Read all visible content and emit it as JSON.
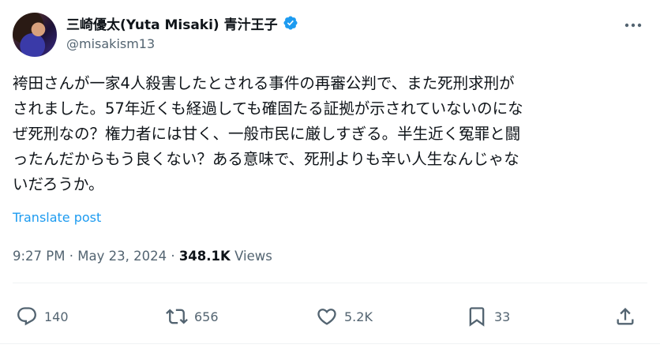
{
  "author": {
    "display_name": "三崎優太(Yuta Misaki) 青汁王子",
    "handle": "@misakism13",
    "verified": true
  },
  "post": {
    "lines": [
      "袴田さんが一家4人殺害したとされる事件の再審公判で、また死刑求刑が",
      "されました。57年近くも経過しても確固たる証拠が示されていないのにな",
      "ぜ死刑なの？権力者には甘く、一般市民に厳しすぎる。半生近く冤罪と闘",
      "ったんだからもう良くない？ある意味で、死刑よりも辛い人生なんじゃな",
      "いだろうか。"
    ],
    "translate_label": "Translate post"
  },
  "meta": {
    "time": "9:27 PM",
    "separator": " · ",
    "date": "May 23, 2024",
    "views_count": "348.1K",
    "views_label": "Views"
  },
  "actions": {
    "replies": "140",
    "reposts": "656",
    "likes": "5.2K",
    "bookmarks": "33"
  },
  "colors": {
    "accent": "#1d9bf0",
    "text": "#0f1419",
    "secondary": "#536471"
  },
  "icons": {
    "more": "more-dots-icon",
    "verified": "verified-badge-icon",
    "reply": "reply-icon",
    "repost": "repost-icon",
    "like": "heart-icon",
    "bookmark": "bookmark-icon",
    "share": "share-icon"
  }
}
